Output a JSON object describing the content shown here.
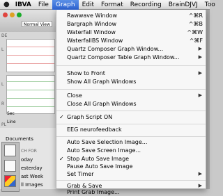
{
  "menubar": {
    "apple_icon": "apple-icon",
    "app_name": "IBVA",
    "items": [
      "File",
      "Graph",
      "Edit",
      "Format",
      "Recording",
      "BrainDJVJ",
      "Too"
    ],
    "active": "Graph"
  },
  "background": {
    "view_select": "Normal View",
    "panel_labels": [
      "DE",
      "L",
      "L",
      "R",
      "PL",
      "Documents",
      "CH FOR",
      "oday",
      "esterday",
      "ast Week",
      "ll Images"
    ],
    "sec_label": "Sec",
    "line_label": "Line"
  },
  "graph_menu": {
    "groups": [
      [
        {
          "label": "Rawwave Window",
          "shortcut": "^⌘R"
        },
        {
          "label": "Bargraph Window",
          "shortcut": "^⌘B"
        },
        {
          "label": "Waterfall Window",
          "shortcut": "^⌘W"
        },
        {
          "label": "WaterfallBS Window",
          "shortcut": "^⌘F"
        },
        {
          "label": "Quartz Composer Graph Window...",
          "submenu": true
        },
        {
          "label": "Quartz Composer Table Graph Window...",
          "submenu": true
        }
      ],
      [
        {
          "label": "Show to Front",
          "submenu": true
        },
        {
          "label": "Show All Graph Windows"
        }
      ],
      [
        {
          "label": "Close",
          "submenu": true
        },
        {
          "label": "Close All Graph Windows"
        }
      ],
      [
        {
          "label": "Graph Script ON",
          "checked": true
        }
      ],
      [
        {
          "label": "EEG neurofeedback"
        }
      ],
      [
        {
          "label": "Auto Save Selection Image..."
        },
        {
          "label": "Auto Save Screen Image..."
        },
        {
          "label": "Stop Auto Save Image",
          "checked": true
        },
        {
          "label": "Pause Auto Save Image"
        },
        {
          "label": "Set Timer",
          "submenu": true
        }
      ],
      [
        {
          "label": "Grab & Save",
          "submenu": true
        },
        {
          "label": "Print Grab Image..."
        }
      ]
    ]
  },
  "colors": {
    "menu_highlight": "#3a6fd8",
    "traffic_red": "#e0443e",
    "traffic_yellow": "#dea123",
    "traffic_green": "#1aab29"
  }
}
